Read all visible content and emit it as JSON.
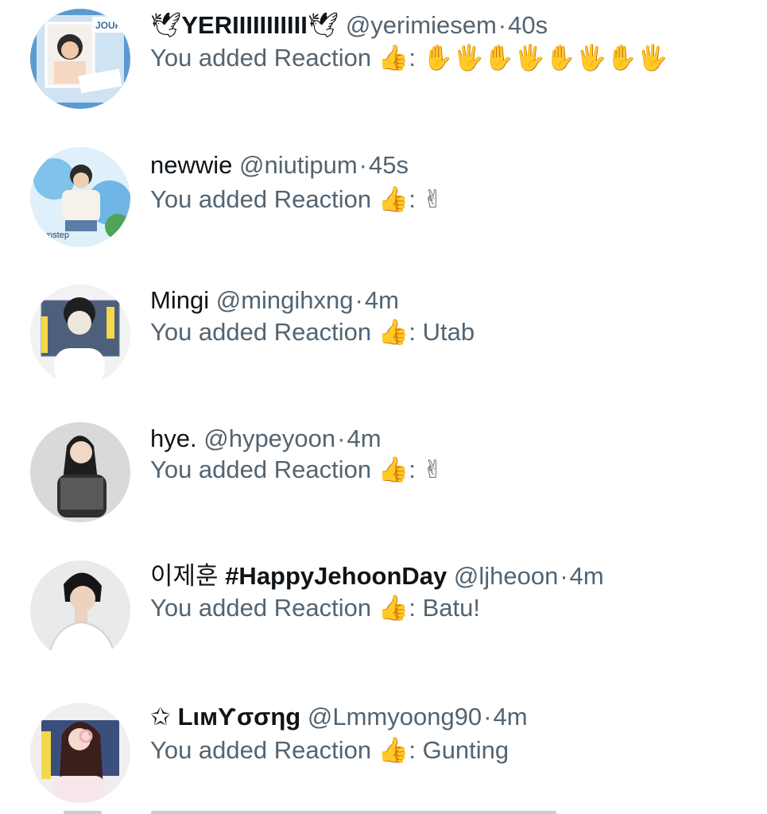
{
  "notifications": [
    {
      "name_prefix": "🕊",
      "name": "YERIIIIIIIIIII",
      "name_suffix": "🕊",
      "handle": "@yerimiesem",
      "time": "40s",
      "reply_prefix": "You added Reaction",
      "reaction_emoji": "👍",
      "reply_value": "✋🖐✋🖐✋🖐✋🖐",
      "avatar_icon": "avatar-journey-frame"
    },
    {
      "name_prefix": "",
      "name": "newwie",
      "name_suffix": "",
      "handle": "@niutipum",
      "time": "45s",
      "reply_prefix": "You added Reaction",
      "reaction_emoji": "👍",
      "reply_value": "✌",
      "avatar_icon": "avatar-blue-art"
    },
    {
      "name_prefix": "",
      "name": "Mingi",
      "name_suffix": "",
      "handle": "@mingihxng",
      "time": "4m",
      "reply_prefix": "You added Reaction",
      "reaction_emoji": "👍",
      "reply_value": "Utab",
      "avatar_icon": "avatar-portrait-grid"
    },
    {
      "name_prefix": "",
      "name": "hye.",
      "name_suffix": "",
      "handle": "@hypeyoon",
      "time": "4m",
      "reply_prefix": "You added Reaction",
      "reaction_emoji": "👍",
      "reply_value": "✌",
      "avatar_icon": "avatar-portrait-grey"
    },
    {
      "name_prefix": "이제훈",
      "name": "#HappyJehoonDay",
      "name_suffix": "",
      "handle": "@ljheoon",
      "time": "4m",
      "reply_prefix": "You added Reaction",
      "reaction_emoji": "👍",
      "reply_value": "Batu!",
      "avatar_icon": "avatar-portrait-suit"
    },
    {
      "name_prefix": "✩",
      "name": "LιмƳσσηg",
      "name_suffix": "",
      "handle": "@Lmmyoong90",
      "time": "4m",
      "reply_prefix": "You added Reaction",
      "reaction_emoji": "👍",
      "reply_value": "Gunting",
      "avatar_icon": "avatar-portrait-aphrodite"
    }
  ],
  "colors": {
    "name": "#0f1419",
    "secondary": "#536471",
    "background": "#ffffff"
  }
}
